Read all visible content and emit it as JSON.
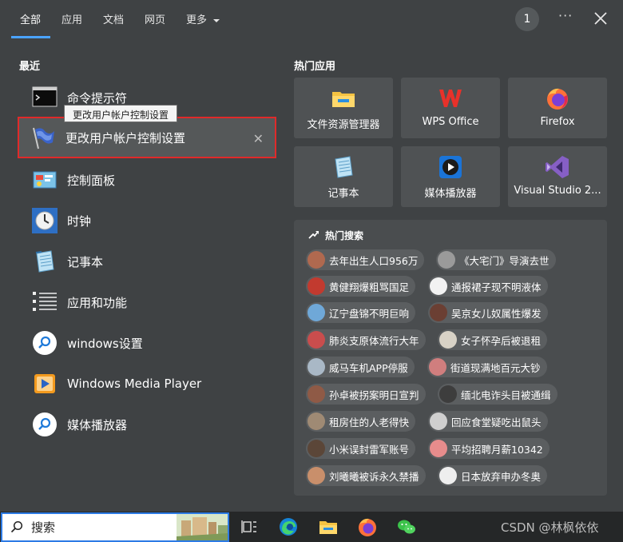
{
  "tabs": [
    {
      "label": "全部",
      "active": true
    },
    {
      "label": "应用"
    },
    {
      "label": "文档"
    },
    {
      "label": "网页"
    },
    {
      "label": "更多"
    }
  ],
  "header": {
    "count": "1",
    "more": "···"
  },
  "recent": {
    "title": "最近",
    "items": [
      {
        "label": "命令提示符",
        "icon": "cmd-icon"
      },
      {
        "label": "更改用户帐户控制设置",
        "icon": "uac-flag-icon",
        "selected": true
      },
      {
        "label": "控制面板",
        "icon": "control-panel-icon"
      },
      {
        "label": "时钟",
        "icon": "clock-icon"
      },
      {
        "label": "记事本",
        "icon": "notepad-icon"
      },
      {
        "label": "应用和功能",
        "icon": "apps-features-icon"
      },
      {
        "label": "windows设置",
        "icon": "settings-search-icon"
      },
      {
        "label": "Windows Media Player",
        "icon": "media-player-icon"
      },
      {
        "label": "媒体播放器",
        "icon": "media-search-icon"
      }
    ],
    "tooltip": "更改用户帐户控制设置"
  },
  "hot_apps": {
    "title": "热门应用",
    "items": [
      {
        "label": "文件资源管理器",
        "icon": "file-explorer-icon"
      },
      {
        "label": "WPS Office",
        "icon": "wps-icon"
      },
      {
        "label": "Firefox",
        "icon": "firefox-icon"
      },
      {
        "label": "记事本",
        "icon": "notepad-icon"
      },
      {
        "label": "媒体播放器",
        "icon": "media-player-icon"
      },
      {
        "label": "Visual Studio 2...",
        "icon": "visual-studio-icon"
      }
    ]
  },
  "hot_search": {
    "title": "热门搜索",
    "items": [
      "去年出生人口956万",
      "《大宅门》导演去世",
      "黄健翔爆粗骂国足",
      "通报裙子现不明液体",
      "辽宁盘锦不明巨响",
      "吴京女儿奴属性爆发",
      "肺炎支原体流行大年",
      "女子怀孕后被退租",
      "威马车机APP停服",
      "街道现满地百元大钞",
      "孙卓被拐案明日宣判",
      "缅北电诈头目被通缉",
      "租房住的人老得快",
      "回应食堂疑吃出鼠头",
      "小米误封雷军账号",
      "平均招聘月薪10342",
      "刘曦曦被诉永久禁播",
      "日本放弃申办冬奥"
    ]
  },
  "taskbar": {
    "search_placeholder": "搜索",
    "watermark": "CSDN @林枫依依"
  },
  "colors": {
    "accent": "#4aa3ff",
    "selection_border": "#e02a2a",
    "background": "#3f4244"
  }
}
